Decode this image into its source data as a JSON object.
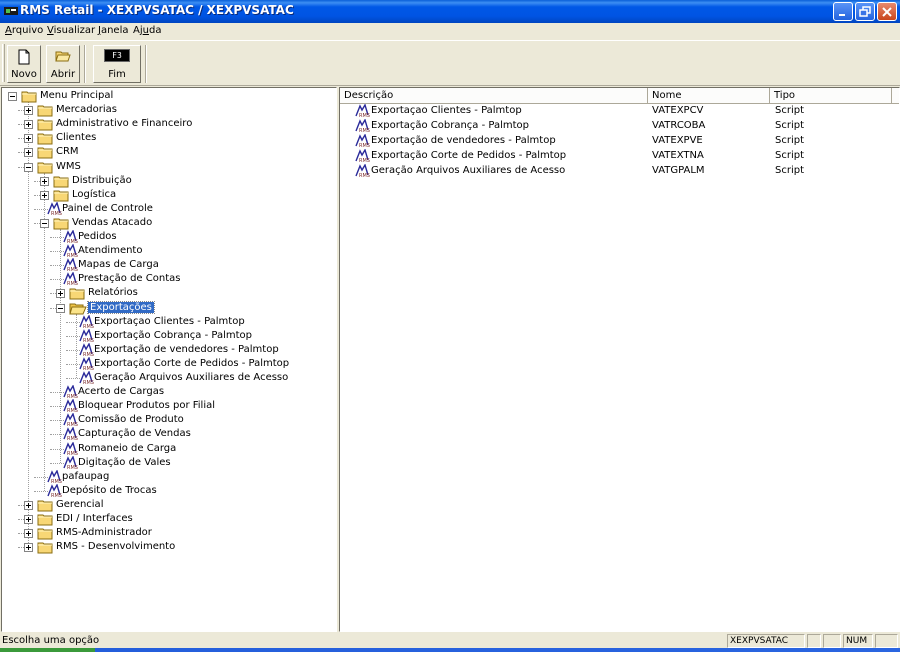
{
  "window": {
    "title": "RMS Retail - XEXPVSATAC / XEXPVSATAC"
  },
  "menu": [
    {
      "pre": "",
      "u": "A",
      "post": "rquivo"
    },
    {
      "pre": "",
      "u": "V",
      "post": "isualizar"
    },
    {
      "pre": "",
      "u": "J",
      "post": "anela"
    },
    {
      "pre": "Aj",
      "u": "u",
      "post": "da"
    }
  ],
  "toolbar": {
    "novo": "Novo",
    "abrir": "Abrir",
    "fim": "Fim",
    "fim_key": "F3"
  },
  "tree": [
    {
      "label": "Menu Principal",
      "type": "folder",
      "level": 0,
      "state": "minus"
    },
    {
      "label": "Mercadorias",
      "type": "folder",
      "level": 1,
      "state": "plus"
    },
    {
      "label": "Administrativo e Financeiro",
      "type": "folder",
      "level": 1,
      "state": "plus"
    },
    {
      "label": "Clientes",
      "type": "folder",
      "level": 1,
      "state": "plus"
    },
    {
      "label": "CRM",
      "type": "folder",
      "level": 1,
      "state": "plus"
    },
    {
      "label": "WMS",
      "type": "folder",
      "level": 1,
      "state": "minus"
    },
    {
      "label": "Distribuição",
      "type": "folder",
      "level": 2,
      "state": "plus"
    },
    {
      "label": "Logística",
      "type": "folder",
      "level": 2,
      "state": "plus"
    },
    {
      "label": "Painel de Controle",
      "type": "script",
      "level": 2
    },
    {
      "label": "Vendas Atacado",
      "type": "folder",
      "level": 2,
      "state": "minus"
    },
    {
      "label": "Pedidos",
      "type": "script",
      "level": 3
    },
    {
      "label": "Atendimento",
      "type": "script",
      "level": 3
    },
    {
      "label": "Mapas de Carga",
      "type": "script",
      "level": 3
    },
    {
      "label": "Prestação de Contas",
      "type": "script",
      "level": 3
    },
    {
      "label": "Relatórios",
      "type": "folder",
      "level": 3,
      "state": "plus"
    },
    {
      "label": "Exportações",
      "type": "folder-open",
      "level": 3,
      "state": "minus",
      "selected": true
    },
    {
      "label": "Exportaçao Clientes - Palmtop",
      "type": "script",
      "level": 4
    },
    {
      "label": "Exportação Cobrança - Palmtop",
      "type": "script",
      "level": 4
    },
    {
      "label": "Exportação de vendedores - Palmtop",
      "type": "script",
      "level": 4
    },
    {
      "label": "Exportação Corte de Pedidos - Palmtop",
      "type": "script",
      "level": 4
    },
    {
      "label": "Geração Arquivos Auxiliares de Acesso",
      "type": "script",
      "level": 4
    },
    {
      "label": "Acerto de Cargas",
      "type": "script",
      "level": 3
    },
    {
      "label": "Bloquear Produtos por Filial",
      "type": "script",
      "level": 3
    },
    {
      "label": "Comissão de Produto",
      "type": "script",
      "level": 3
    },
    {
      "label": "Capturação de Vendas",
      "type": "script",
      "level": 3
    },
    {
      "label": "Romaneio de Carga",
      "type": "script",
      "level": 3
    },
    {
      "label": "Digitação de Vales",
      "type": "script",
      "level": 3
    },
    {
      "label": "pafaupag",
      "type": "script",
      "level": 2
    },
    {
      "label": "Depósito de Trocas",
      "type": "script",
      "level": 2
    },
    {
      "label": "Gerencial",
      "type": "folder",
      "level": 1,
      "state": "plus"
    },
    {
      "label": "EDI / Interfaces",
      "type": "folder",
      "level": 1,
      "state": "plus"
    },
    {
      "label": "RMS-Administrador",
      "type": "folder",
      "level": 1,
      "state": "plus"
    },
    {
      "label": "RMS - Desenvolvimento",
      "type": "folder",
      "level": 1,
      "state": "plus"
    }
  ],
  "list": {
    "columns": [
      "Descrição",
      "Nome",
      "Tipo"
    ],
    "rows": [
      [
        "Exportaçao Clientes - Palmtop",
        "VATEXPCV",
        "Script"
      ],
      [
        "Exportação Cobrança - Palmtop",
        "VATRCOBA",
        "Script"
      ],
      [
        "Exportação de vendedores - Palmtop",
        "VATEXPVE",
        "Script"
      ],
      [
        "Exportação Corte de Pedidos - Palmtop",
        "VATEXTNA",
        "Script"
      ],
      [
        "Geração Arquivos Auxiliares de Acesso",
        "VATGPALM",
        "Script"
      ]
    ]
  },
  "status": {
    "message": "Escolha uma opção",
    "program": "XEXPVSATAC",
    "num": "NUM"
  },
  "colors": {
    "titlebar": "#0054e3",
    "selection": "#316ac5",
    "folder": "#f8d775",
    "taskbar_green": "#3b9a3b"
  }
}
